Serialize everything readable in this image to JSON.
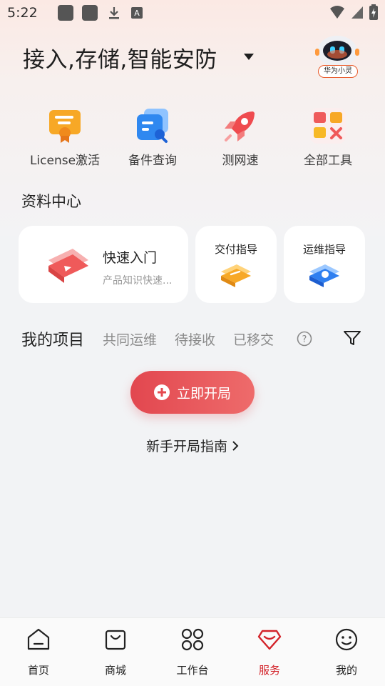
{
  "status_bar": {
    "time": "5:22"
  },
  "header": {
    "headline": "接入,存储,智能安防",
    "mascot_label": "华为小灵"
  },
  "tools": [
    {
      "label": "License激活",
      "icon": "license-badge-icon"
    },
    {
      "label": "备件查询",
      "icon": "spare-parts-search-icon"
    },
    {
      "label": "测网速",
      "icon": "rocket-icon"
    },
    {
      "label": "全部工具",
      "icon": "all-tools-grid-icon"
    }
  ],
  "resources": {
    "title": "资料中心",
    "quick_start": {
      "title": "快速入门",
      "subtitle": "产品知识快速..."
    },
    "delivery_guide": "交付指导",
    "ops_guide": "运维指导"
  },
  "projects": {
    "title": "我的项目",
    "tabs": [
      "共同运维",
      "待接收",
      "已移交"
    ]
  },
  "actions": {
    "start_button": "立即开局",
    "guide_link": "新手开局指南"
  },
  "bottom_nav": [
    {
      "label": "首页",
      "active": false
    },
    {
      "label": "商城",
      "active": false
    },
    {
      "label": "工作台",
      "active": false
    },
    {
      "label": "服务",
      "active": true
    },
    {
      "label": "我的",
      "active": false
    }
  ],
  "colors": {
    "accent": "#e2474f",
    "active_tab": "#d3232a"
  }
}
